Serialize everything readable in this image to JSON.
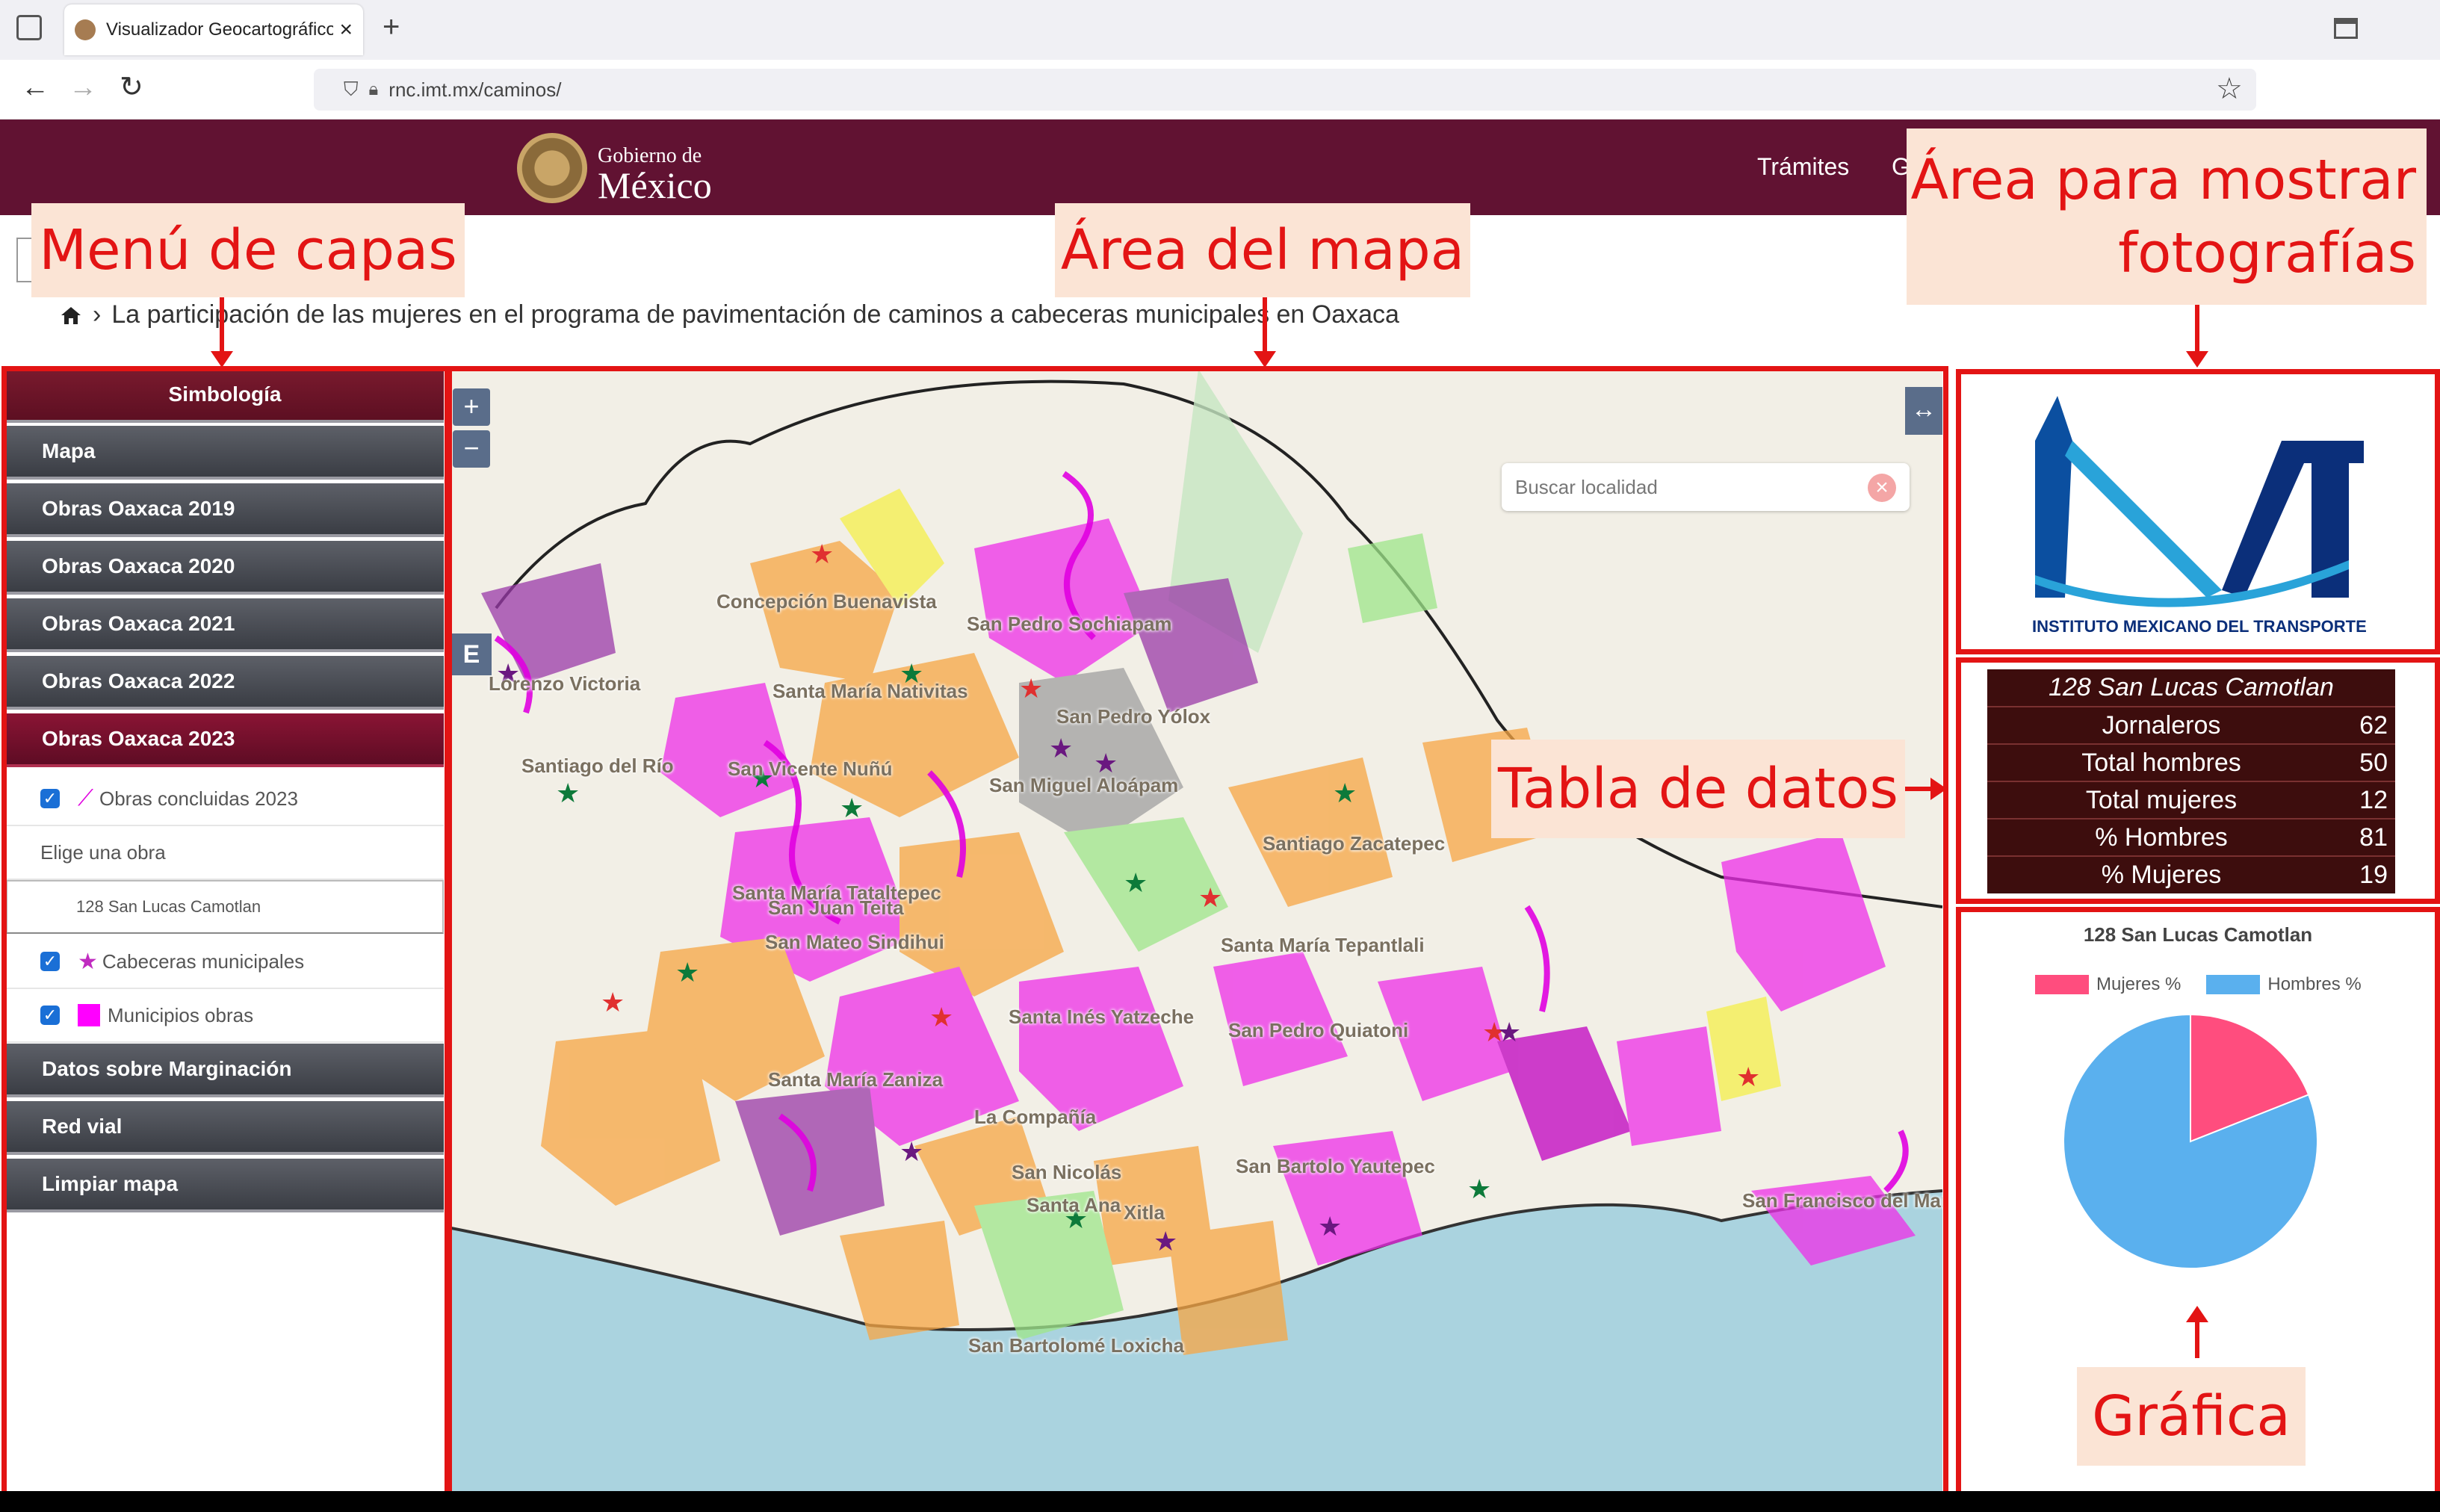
{
  "browser": {
    "tab_title": "Visualizador Geocartográfico de",
    "url": "rnc.imt.mx/caminos/"
  },
  "gov_header": {
    "line1": "Gobierno de",
    "line2": "México",
    "nav_tramites": "Trámites",
    "nav_partial": "G"
  },
  "breadcrumb": "La participación de las mujeres en el programa de pavimentación de caminos a cabeceras municipales en Oaxaca",
  "annotations": {
    "menu": "Menú de capas",
    "mapa": "Área del mapa",
    "fotos_l1": "Área para mostrar",
    "fotos_l2": "fotografías",
    "tabla": "Tabla de datos",
    "grafica": "Gráfica"
  },
  "sidebar": {
    "title": "Simbología",
    "items": [
      {
        "label": "Mapa"
      },
      {
        "label": "Obras Oaxaca 2019"
      },
      {
        "label": "Obras Oaxaca 2020"
      },
      {
        "label": "Obras Oaxaca 2021"
      },
      {
        "label": "Obras Oaxaca 2022"
      },
      {
        "label": "Obras Oaxaca 2023"
      }
    ],
    "layer_obras": "Obras concluidas 2023",
    "choose_label": "Elige una obra",
    "selected_obra": "128 San Lucas Camotlan",
    "layer_cabeceras": "Cabeceras municipales",
    "layer_municipios": "Municipios obras",
    "bottom_items": [
      {
        "label": "Datos sobre Marginación"
      },
      {
        "label": "Red vial"
      },
      {
        "label": "Limpiar mapa"
      }
    ]
  },
  "map": {
    "search_placeholder": "Buscar localidad",
    "zoom_in": "+",
    "zoom_out": "−",
    "e_button": "E",
    "expand": "↔",
    "towns": [
      "Concepción Buenavista",
      "Santa María Nativitas",
      "San Pedro Sochiapam",
      "San Pedro Yólox",
      "Santiago del Río",
      "San Vicente Nuñú",
      "San Miguel Aloápam",
      "Santiago Zacatepec",
      "Santa María Tataltepec",
      "San Juan Teita",
      "San Mateo Sindihui",
      "Santa María Tepantlali",
      "Santa Inés Yatzeche",
      "San Pedro Quiatoni",
      "Santa María Zaniza",
      "La Compañía",
      "San Bartolo Yautepec",
      "San Nicolás",
      "Santa Ana",
      "San Francisco del Mar",
      "San Bartolomé Loxicha",
      "Lorenzo Victoria",
      "Xitla"
    ]
  },
  "data_table": {
    "title": "128 San Lucas Camotlan",
    "rows": [
      {
        "label": "Jornaleros",
        "value": "62"
      },
      {
        "label": "Total hombres",
        "value": "50"
      },
      {
        "label": "Total mujeres",
        "value": "12"
      },
      {
        "label": "% Hombres",
        "value": "81"
      },
      {
        "label": "% Mujeres",
        "value": "19"
      }
    ]
  },
  "chart_data": {
    "type": "pie",
    "title": "128 San Lucas Camotlan",
    "categories": [
      "Mujeres %",
      "Hombres %"
    ],
    "values": [
      19,
      81
    ],
    "colors": [
      "#ff4d7e",
      "#5ab0ee"
    ],
    "legend": "top"
  },
  "logo": {
    "text": "INSTITUTO MEXICANO DEL TRANSPORTE"
  },
  "colors": {
    "gov_maroon": "#611232",
    "annotation_red": "#e31414",
    "annotation_bg": "#fbe4d5",
    "table_bg": "#3d0d0d"
  }
}
